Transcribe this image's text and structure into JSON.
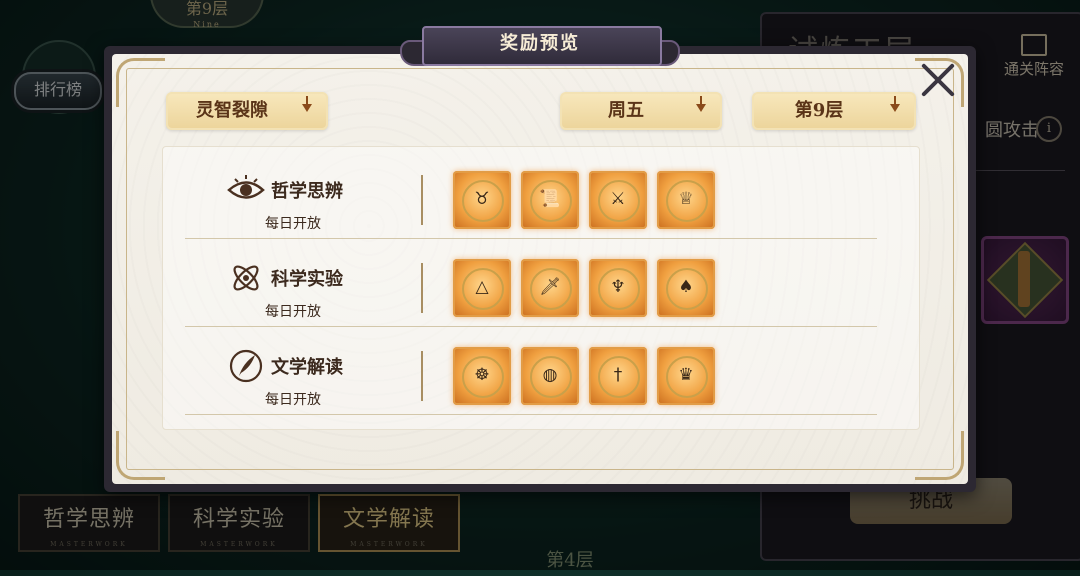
{
  "background": {
    "top_floor_label": "第9层",
    "top_floor_sub": "Nine",
    "rank_button": "排行榜",
    "right_title": "试炼工层",
    "lineup_label": "通关阵容",
    "attack_label": "圆攻击",
    "info_icon_text": "i",
    "challenge_label": "挑战",
    "tabs": [
      {
        "label": "哲学思辨",
        "sub": "MASTERWORK",
        "active": false
      },
      {
        "label": "科学实验",
        "sub": "MASTERWORK",
        "active": false
      },
      {
        "label": "文学解读",
        "sub": "MASTERWORK",
        "active": true
      }
    ],
    "bottom_floor": "第4层"
  },
  "modal": {
    "title": "奖励预览",
    "dropdowns": {
      "mode": "灵智裂隙",
      "day": "周五",
      "floor": "第9层"
    },
    "rows": [
      {
        "name": "哲学思辨",
        "schedule": "每日开放",
        "icon": "eye-icon",
        "rewards": [
          {
            "name": "ox-cart-medal-icon",
            "glyph": "♉"
          },
          {
            "name": "scroll-medal-icon",
            "glyph": "📜"
          },
          {
            "name": "axe-medal-icon",
            "glyph": "⚔"
          },
          {
            "name": "chalice-medal-icon",
            "glyph": "♕"
          }
        ]
      },
      {
        "name": "科学实验",
        "schedule": "每日开放",
        "icon": "atom-icon",
        "rewards": [
          {
            "name": "eye-pyramid-medal-icon",
            "glyph": "△"
          },
          {
            "name": "dagger-medal-icon",
            "glyph": "🗡"
          },
          {
            "name": "lamp-medal-icon",
            "glyph": "♆"
          },
          {
            "name": "spearhead-medal-icon",
            "glyph": "♠"
          }
        ]
      },
      {
        "name": "文学解读",
        "schedule": "每日开放",
        "icon": "quill-icon",
        "rewards": [
          {
            "name": "scarab-medal-icon",
            "glyph": "☸"
          },
          {
            "name": "crystal-ball-medal-icon",
            "glyph": "◍"
          },
          {
            "name": "sword-medal-icon",
            "glyph": "†"
          },
          {
            "name": "winged-emblem-medal-icon",
            "glyph": "♛"
          }
        ]
      }
    ]
  },
  "colors": {
    "accent_gold": "#ecd49a",
    "reward_orange": "#f0a040",
    "title_plate": "#3c3648",
    "text_dark": "#3c2a1e"
  }
}
